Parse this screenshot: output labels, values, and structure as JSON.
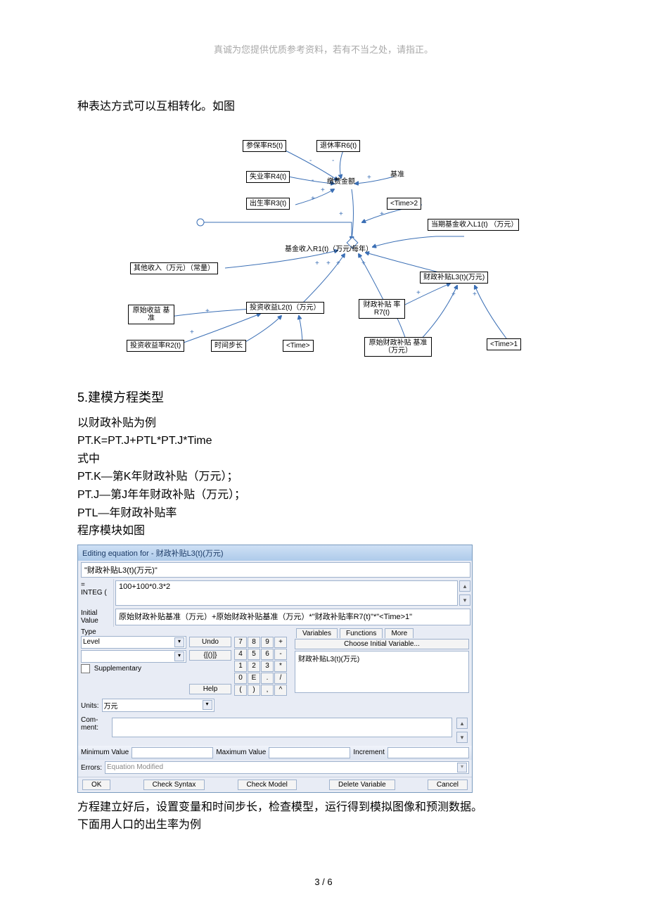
{
  "header_note": "真诚为您提供优质参考资料，若有不当之处，请指正。",
  "intro_line": "种表达方式可以互相转化。如图",
  "diagram": {
    "nodes": {
      "r5": "参保率R5(t)",
      "r6": "退休率R6(t)",
      "r4": "失业率R4(t)",
      "jfe": "缴费金额",
      "jz": "基准",
      "r3": "出生率R3(t)",
      "time2": "<Time>2",
      "l1": "当期基金收入L1(t)\n（万元）",
      "r1": "基金收入R1(t)（万元/每年）",
      "other": "其他收入（万元）（常量）",
      "l2": "投资收益L2(t)（万元）",
      "r7": "财政补贴\n率R7(t)",
      "l3": "财政补贴L3(t)(万元)",
      "ysy": "原始收益\n基准",
      "r2": "投资收益率R2(t)",
      "step": "时间步长",
      "time": "<Time>",
      "yscb": "原始财政补贴\n基准（万元）",
      "time1": "<Time>1"
    }
  },
  "section5_title": "5.建模方程类型",
  "body": {
    "l1": "以财政补贴为例",
    "l2": "PT.K=PT.J+PTL*PT.J*Time",
    "l3": "式中",
    "l4": "PT.K—第K年财政补贴（万元）；",
    "l5": "PT.J—第J年年财政补贴（万元）；",
    "l6": "PTL—年财政补贴率",
    "l7": "程序模块如图"
  },
  "editor": {
    "title": "Editing equation for - 财政补贴L3(t)(万元)",
    "nameField": "\"财政补贴L3(t)(万元)\"",
    "integLabel": "=\nINTEG (",
    "integField": "100+100*0.3*2",
    "initialLabel": "Initial\nValue",
    "initialField": "原始财政补贴基准（万元）+原始财政补贴基准（万元）*\"财政补贴率R7(t)\"*\"<Time>1\"",
    "typeLabel": "Type",
    "typeSelect": "Level",
    "btn_undo": "Undo",
    "btn_help": "Help",
    "supplementary": "Supplementary",
    "bracket_btn": "{[()]}",
    "keypad": [
      "7",
      "8",
      "9",
      "+",
      "4",
      "5",
      "6",
      "-",
      "1",
      "2",
      "3",
      "*",
      "0",
      "E",
      ".",
      "/",
      "(",
      ")",
      ",",
      "^"
    ],
    "tab_variables": "Variables",
    "tab_functions": "Functions",
    "tab_more": "More",
    "choose_initial": "Choose Initial Variable...",
    "list_item": "财政补贴L3(t)(万元)",
    "unitsLabel": "Units:",
    "unitsValue": "万元",
    "commentLabel": "Com-\nment:",
    "minLabel": "Minimum Value",
    "maxLabel": "Maximum Value",
    "incrLabel": "Increment",
    "errorsLabel": "Errors:",
    "errorsValue": "Equation Modified",
    "btn_ok": "OK",
    "btn_checkSyntax": "Check Syntax",
    "btn_checkModel": "Check Model",
    "btn_deleteVar": "Delete Variable",
    "btn_cancel": "Cancel"
  },
  "after1": "方程建立好后，设置变量和时间步长，检查模型，运行得到模拟图像和预测数据。",
  "after2": "下面用人口的出生率为例",
  "footer": "3 / 6"
}
